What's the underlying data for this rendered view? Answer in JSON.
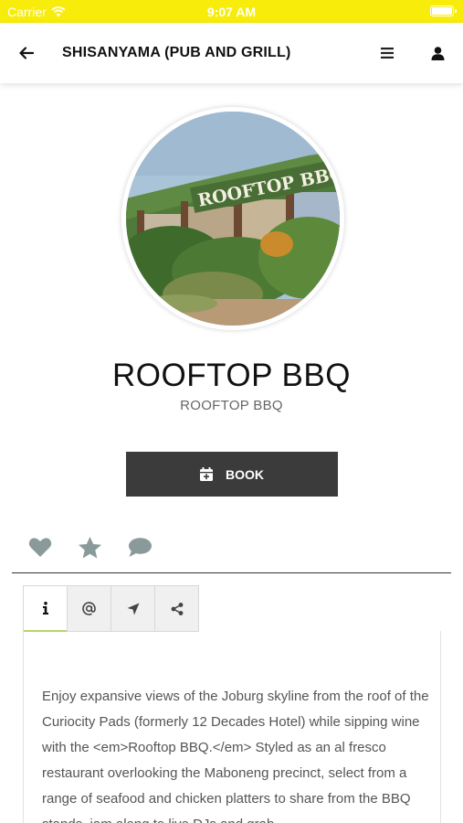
{
  "status_bar": {
    "carrier": "Carrier",
    "time": "9:07 AM"
  },
  "header": {
    "title": "SHISANYAMA (PUB AND GRILL)"
  },
  "venue": {
    "name": "ROOFTOP BBQ",
    "subtitle": "ROOFTOP BBQ",
    "sign_text": "ROOFTOP BBQ"
  },
  "book_button": {
    "label": "BOOK"
  },
  "actions": [
    "heart-icon",
    "star-icon",
    "comment-icon"
  ],
  "tabs": [
    "info-icon",
    "at-icon",
    "location-arrow-icon",
    "share-icon"
  ],
  "description": "Enjoy expansive views of the Joburg skyline from the roof of the Curiocity Pads (formerly 12 Decades Hotel) while sipping wine with the <em>Rooftop BBQ.</em> Styled as an al fresco restaurant overlooking the Maboneng precinct, select from a range of seafood and chicken platters to share from the BBQ stands, jam along to live DJs and grab",
  "colors": {
    "status_bar": "#f7ec0a",
    "button": "#3b3b3b",
    "icon_gray": "#8a9a9a",
    "active_tab": "#b5d56a"
  }
}
